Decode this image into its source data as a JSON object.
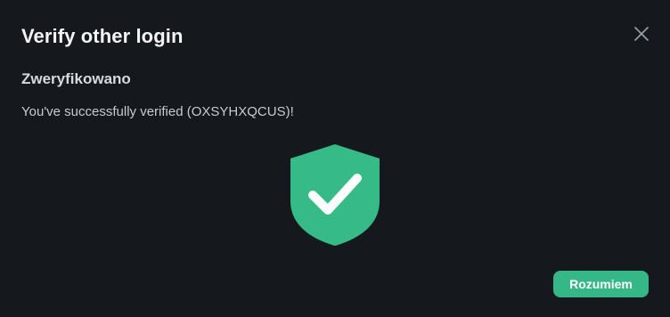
{
  "dialog": {
    "title": "Verify other login",
    "subtitle": "Zweryfikowano",
    "message": "You've successfully verified (OXSYHXQCUS)!",
    "confirm_label": "Rozumiem",
    "close_icon": "close-icon",
    "status_icon": "shield-check-icon"
  },
  "colors": {
    "background": "#15191e",
    "accent": "#36b787",
    "shield": "#35ba88"
  }
}
